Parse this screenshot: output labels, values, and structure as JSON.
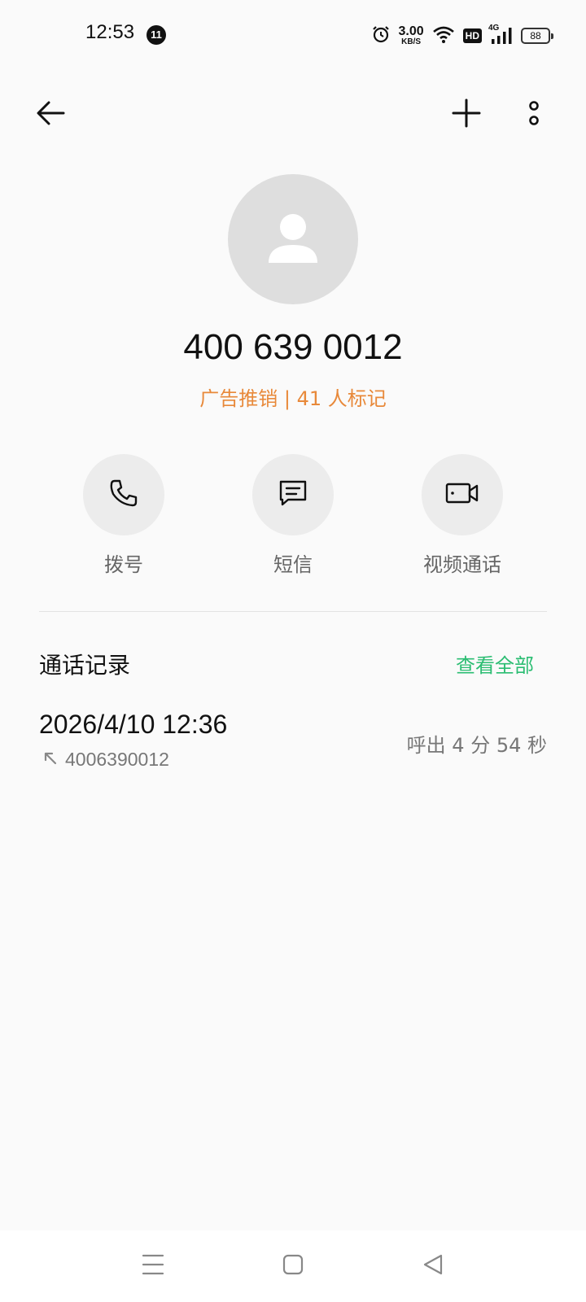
{
  "status_bar": {
    "time": "12:53",
    "notification_count": "11",
    "net_speed_value": "3.00",
    "net_speed_unit": "KB/S",
    "hd_label": "HD",
    "network_type": "4G",
    "battery": "88"
  },
  "contact": {
    "number": "400 639 0012",
    "tag": "广告推销 | 41 人标记"
  },
  "actions": {
    "dial_label": "拨号",
    "sms_label": "短信",
    "video_label": "视频通话"
  },
  "call_log": {
    "title": "通话记录",
    "view_all": "查看全部",
    "records": [
      {
        "datetime": "2026/4/10 12:36",
        "number": "4006390012",
        "info": "呼出  4 分 54 秒"
      }
    ]
  },
  "colors": {
    "tag": "#e8893a",
    "accent_green": "#2bbd72",
    "background": "#fafafa"
  },
  "icons": {
    "back": "arrow-left-icon",
    "add": "plus-icon",
    "more": "more-vertical-icon",
    "avatar": "person-icon",
    "dial": "phone-icon",
    "sms": "message-icon",
    "video": "video-camera-icon",
    "outgoing": "outgoing-call-icon"
  }
}
